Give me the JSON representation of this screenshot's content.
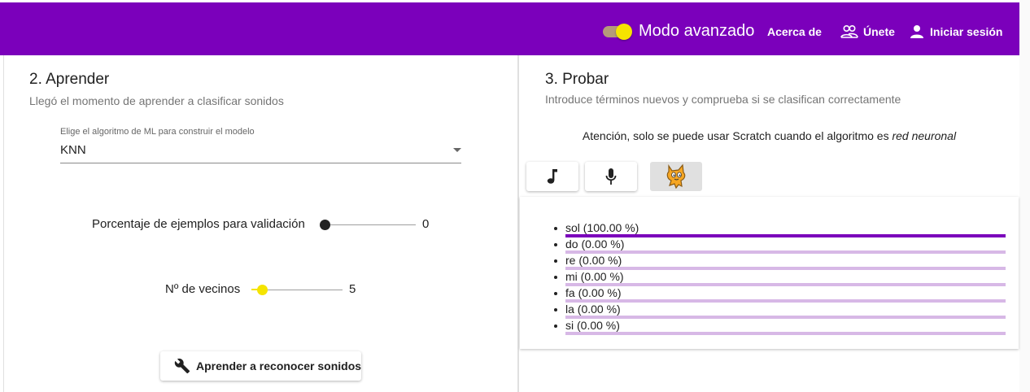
{
  "header": {
    "mode_label": "Modo avanzado",
    "mode_enabled": true,
    "about_label": "Acerca de",
    "join_label": "Únete",
    "login_label": "Iniciar sesión",
    "colors": {
      "bar": "#7b00bb",
      "toggle_thumb": "#f5e400",
      "toggle_track": "#b59a7a"
    }
  },
  "learn": {
    "title": "2. Aprender",
    "subtitle": "Llegó el momento de aprender a clasificar sonidos",
    "algorithm_select": {
      "label": "Elige el algoritmo de ML para construir el modelo",
      "value": "KNN"
    },
    "validation_slider": {
      "label": "Porcentaje de ejemplos para validación",
      "value": "0",
      "fraction": 0.0
    },
    "neighbors_slider": {
      "label": "Nº de vecinos",
      "value": "5",
      "fraction": 0.12
    },
    "train_button": "Aprender a reconocer sonidos"
  },
  "test": {
    "title": "3. Probar",
    "subtitle": "Introduce términos nuevos y comprueba si se clasifican correctamente",
    "notice_text": "Atención, solo se puede usar Scratch cuando el algoritmo es ",
    "notice_emphasis": "red neuronal",
    "tools": [
      {
        "icon": "music-note-icon",
        "active": false
      },
      {
        "icon": "microphone-icon",
        "active": false
      },
      {
        "icon": "scratch-cat-icon",
        "active": true
      }
    ],
    "results": [
      {
        "label": "sol (100.00 %)",
        "fraction": 1.0
      },
      {
        "label": "do (0.00 %)",
        "fraction": 0.0
      },
      {
        "label": "re (0.00 %)",
        "fraction": 0.0
      },
      {
        "label": "mi (0.00 %)",
        "fraction": 0.0
      },
      {
        "label": "fa (0.00 %)",
        "fraction": 0.0
      },
      {
        "label": "la (0.00 %)",
        "fraction": 0.0
      },
      {
        "label": "si (0.00 %)",
        "fraction": 0.0
      }
    ]
  }
}
